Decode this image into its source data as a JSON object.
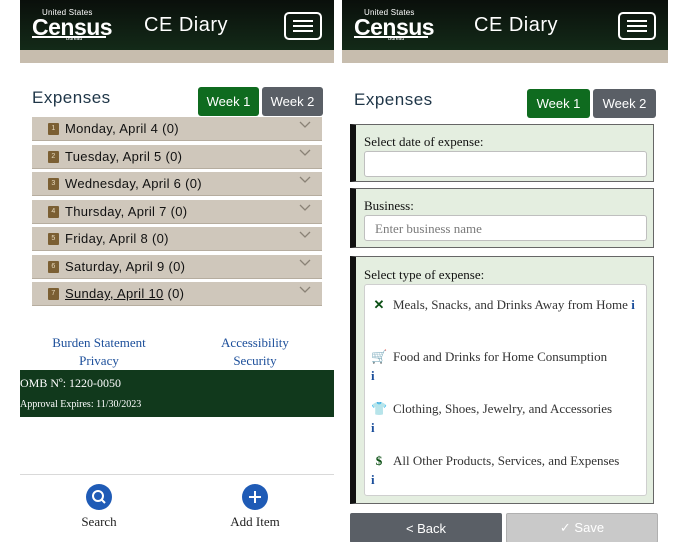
{
  "header": {
    "logo": {
      "top": "United States",
      "main": "Census",
      "sub": "Bureau"
    },
    "title": "CE Diary",
    "menu_icon": "hamburger-menu-icon"
  },
  "expenses": {
    "title": "Expenses",
    "week_tabs": [
      "Week 1",
      "Week 2"
    ],
    "active_week": "Week 1"
  },
  "days": [
    {
      "num": "1",
      "label": "Monday, April 4",
      "count": "(0)"
    },
    {
      "num": "2",
      "label": "Tuesday, April 5",
      "count": "(0)"
    },
    {
      "num": "3",
      "label": "Wednesday, April 6",
      "count": "(0)"
    },
    {
      "num": "4",
      "label": "Thursday, April 7",
      "count": "(0)"
    },
    {
      "num": "5",
      "label": "Friday, April 8",
      "count": "(0)"
    },
    {
      "num": "6",
      "label": "Saturday, April 9",
      "count": "(0)"
    },
    {
      "num": "7",
      "label": "Sunday, April 10",
      "count": "(0)"
    }
  ],
  "footer": {
    "links": [
      "Burden Statement",
      "Accessibility",
      "Privacy",
      "Security"
    ],
    "omb_number": "OMB Nº: 1220-0050",
    "approval": "Approval Expires: 11/30/2023"
  },
  "bottom_nav": [
    {
      "label": "Search",
      "icon": "search-icon"
    },
    {
      "label": "Add Item",
      "icon": "plus-icon"
    }
  ],
  "form": {
    "date_label": "Select date of expense:",
    "date_value": "",
    "business_label": "Business:",
    "business_placeholder": "Enter business name",
    "type_label": "Select type of expense:",
    "types": [
      {
        "label": "Meals, Snacks, and Drinks Away from Home",
        "icon": "utensils-icon",
        "info": "i"
      },
      {
        "label": "Food and Drinks for Home Consumption",
        "icon": "shopping-cart-icon",
        "info": "i"
      },
      {
        "label": "Clothing, Shoes, Jewelry, and Accessories",
        "icon": "tshirt-icon",
        "info": "i"
      },
      {
        "label": "All Other Products, Services, and Expenses",
        "icon": "dollar-icon",
        "info": "i"
      }
    ],
    "back_label": "< Back",
    "save_label": "✓ Save"
  },
  "colors": {
    "header_bg": "#0f2414",
    "accent_green": "#0f6b1f",
    "tab_inactive": "#5a5f66",
    "stripe": "#c7bdae",
    "link_blue": "#1b4e9a"
  }
}
